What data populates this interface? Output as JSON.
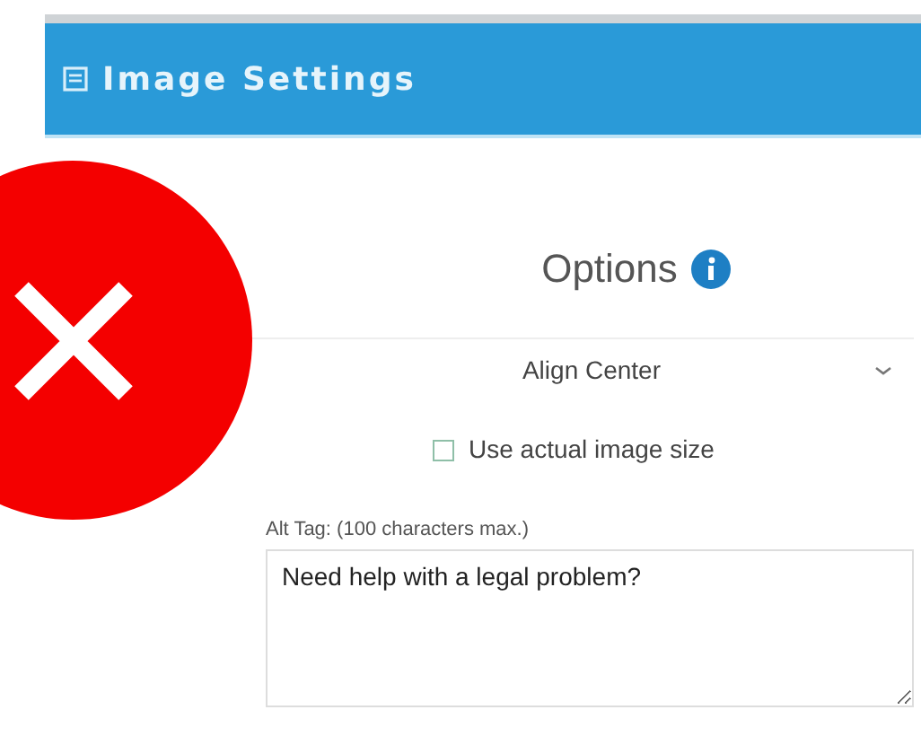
{
  "window": {
    "title": "Image Settings"
  },
  "options": {
    "heading": "Options",
    "alignment": {
      "value": "Align Center"
    },
    "actual_size": {
      "label": "Use actual image size",
      "checked": false
    },
    "alt_tag": {
      "label": "Alt Tag: (100 characters max.)",
      "value": "Need help with a legal problem?"
    }
  },
  "overlay": {
    "kind": "error"
  }
}
